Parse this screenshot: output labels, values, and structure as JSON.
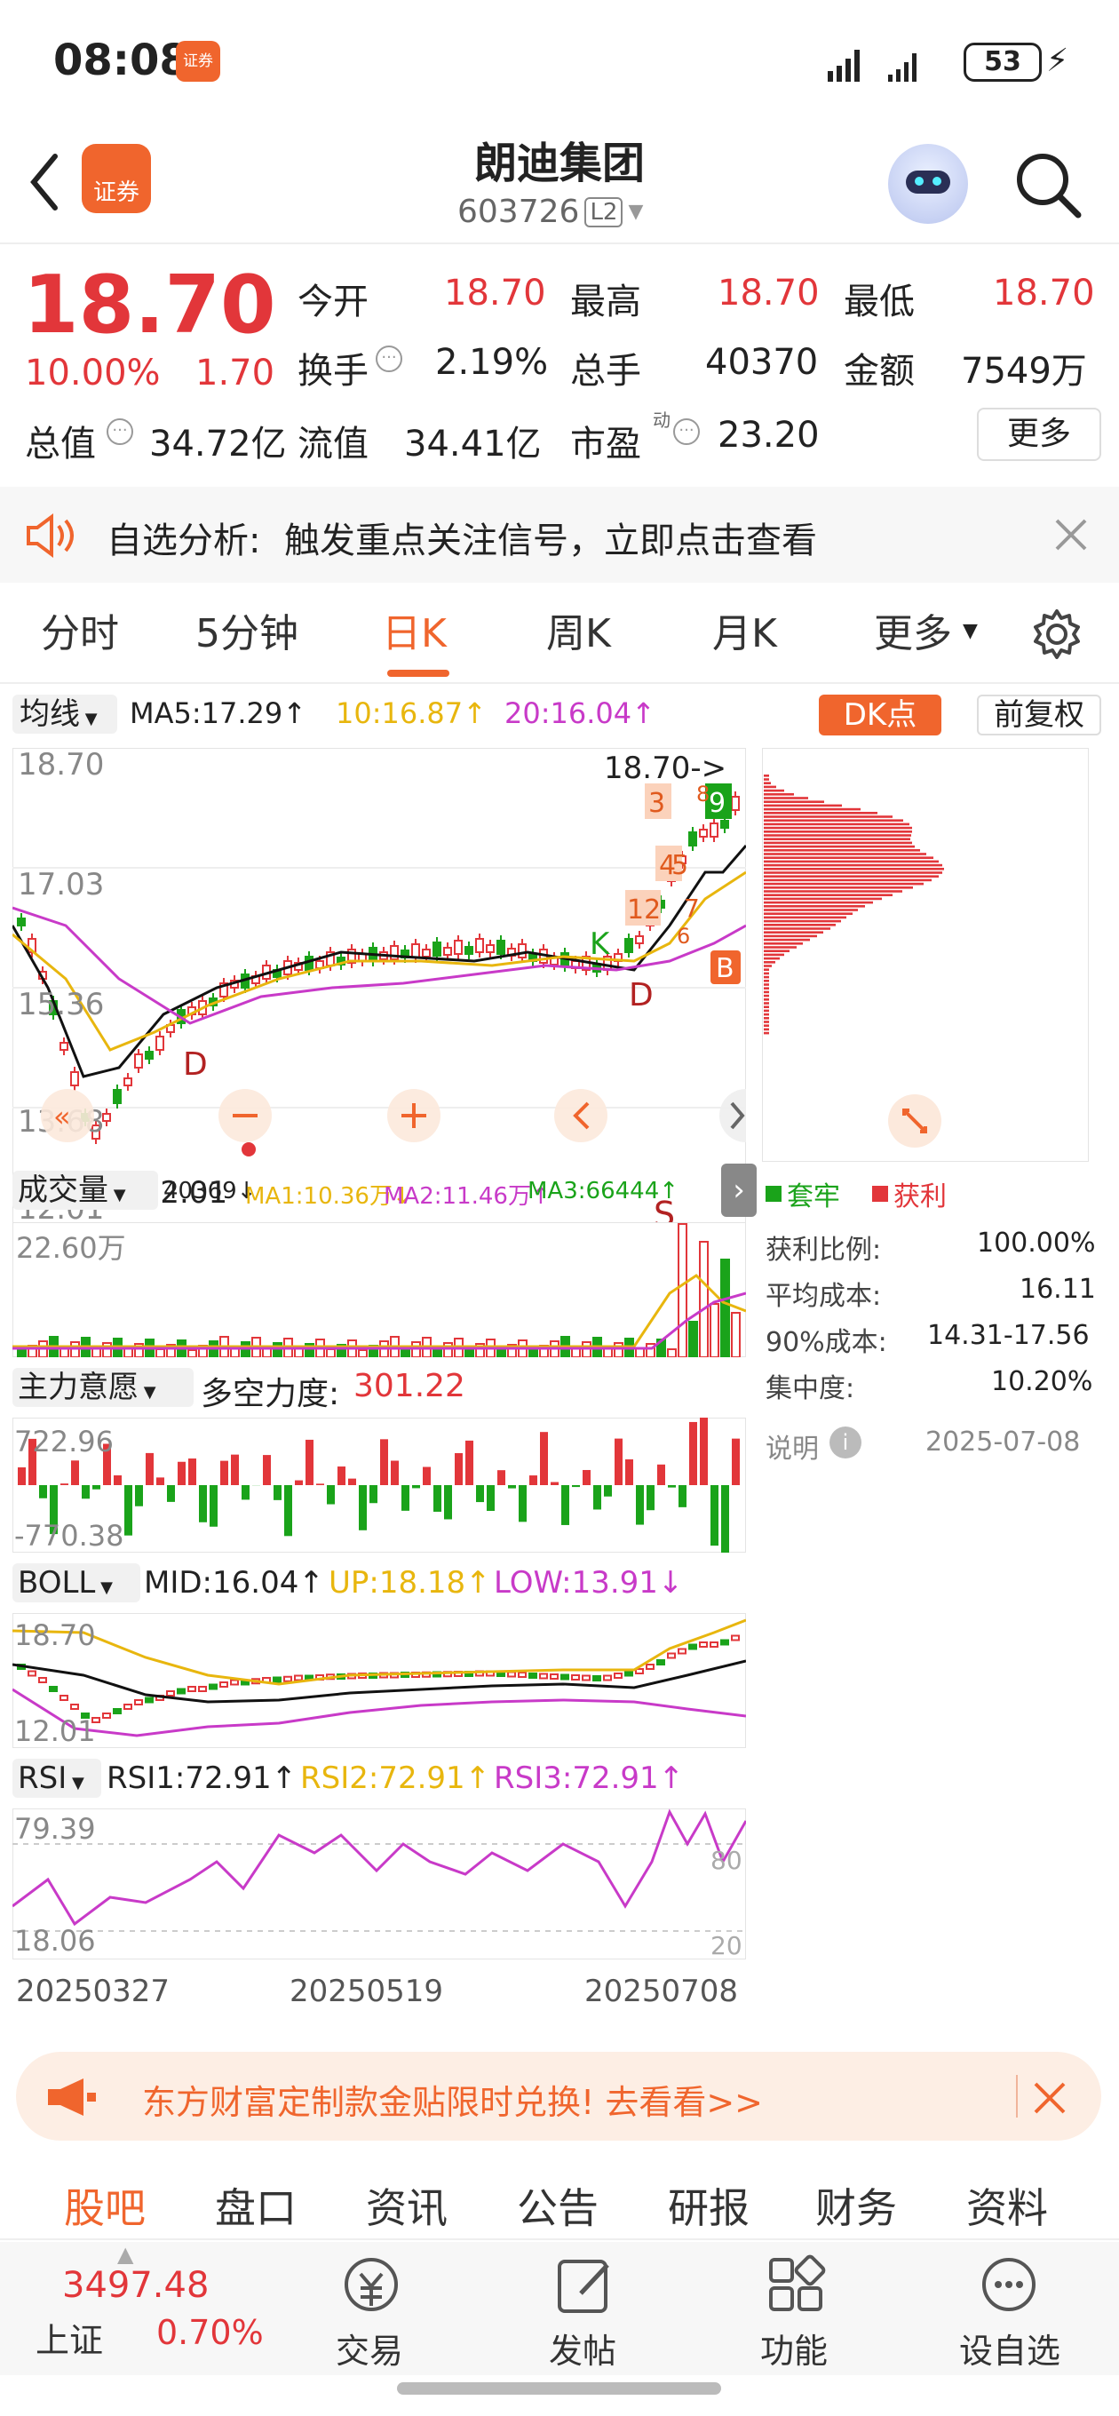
{
  "status_bar": {
    "time": "08:08",
    "app_badge": "证券",
    "battery": "53"
  },
  "header": {
    "back_icon": "chevron-left-icon",
    "app_icon": "证券",
    "stock_name": "朗迪集团",
    "stock_code": "603726",
    "level": "L2",
    "mascot": "robot-avatar",
    "search_icon": "search-icon"
  },
  "quote": {
    "price": "18.70",
    "change_pct": "10.00%",
    "change_amt": "1.70",
    "open_label": "今开",
    "open": "18.70",
    "high_label": "最高",
    "high": "18.70",
    "low_label": "最低",
    "low": "18.70",
    "turnover_label": "换手",
    "turnover": "2.19%",
    "volume_label": "总手",
    "volume": "40370",
    "amount_label": "金额",
    "amount": "7549万",
    "mcap_label": "总值",
    "mcap": "34.72亿",
    "float_label": "流值",
    "float_mcap": "34.41亿",
    "pe_label": "市盈",
    "pe_sup": "动",
    "pe": "23.20",
    "more": "更多"
  },
  "notice": {
    "prefix": "自选分析:",
    "text": "触发重点关注信号，立即点击查看"
  },
  "tabs": [
    "分时",
    "5分钟",
    "日K",
    "周K",
    "月K",
    "更多"
  ],
  "active_tab": "日K",
  "ma_bar": {
    "selector": "均线",
    "ma5": "MA5:17.29↑",
    "ma10": "10:16.87↑",
    "ma20": "20:16.04↑",
    "dk": "DK点",
    "adjust": "前复权"
  },
  "kline": {
    "y_top": "18.70",
    "y2": "17.03",
    "y3": "15.36",
    "y4": "13.68",
    "y_bottom": "12.01",
    "max_label": "18.70->",
    "min_label": "<-12.01",
    "markers": [
      "3",
      "9",
      "8",
      "4",
      "5",
      "12",
      "7",
      "6",
      "B",
      "K",
      "D",
      "D",
      "S"
    ]
  },
  "chip": {
    "legend_trapped": "套牢",
    "legend_profit": "获利",
    "profit_ratio_label": "获利比例:",
    "profit_ratio": "100.00%",
    "avg_cost_label": "平均成本:",
    "avg_cost": "16.11",
    "cost90_label": "90%成本:",
    "cost90": "14.31-17.56",
    "concentration_label": "集中度:",
    "concentration": "10.20%",
    "explain": "说明",
    "date": "2025-07-08"
  },
  "volume_panel": {
    "selector": "成交量",
    "vol": "40369↓",
    "ma1": "MA1:10.36万↓",
    "ma2": "MA2:11.46万↑",
    "ma3": "MA3:66444↑",
    "y_top": "22.60万"
  },
  "power_panel": {
    "selector": "主力意愿",
    "label": "多空力度:",
    "value": "301.22",
    "y_top": "722.96",
    "y_bottom": "-770.38"
  },
  "boll_panel": {
    "selector": "BOLL",
    "mid": "MID:16.04↑",
    "up": "UP:18.18↑",
    "low": "LOW:13.91↓",
    "y_top": "18.70",
    "y_bottom": "12.01"
  },
  "rsi_panel": {
    "selector": "RSI",
    "rsi1": "RSI1:72.91↑",
    "rsi2": "RSI2:72.91↑",
    "rsi3": "RSI3:72.91↑",
    "y_top": "79.39",
    "y_bottom": "18.06",
    "ref80": "80",
    "ref20": "20"
  },
  "dates": [
    "20250327",
    "20250519",
    "20250708"
  ],
  "banner": {
    "text": "东方财富定制款金贴限时兑换!  去看看>>"
  },
  "bottom_tabs": [
    "股吧",
    "盘口",
    "资讯",
    "公告",
    "研报",
    "财务",
    "资料"
  ],
  "bottom_bar": {
    "index_value": "3497.48",
    "index_name": "上证",
    "index_pct": "0.70%",
    "items": [
      "交易",
      "发帖",
      "功能",
      "设自选"
    ]
  },
  "colors": {
    "up": "#e2363a",
    "down": "#1aa31a",
    "accent": "#f0652d",
    "ma10": "#e8b60e",
    "ma20": "#c83ac8"
  }
}
